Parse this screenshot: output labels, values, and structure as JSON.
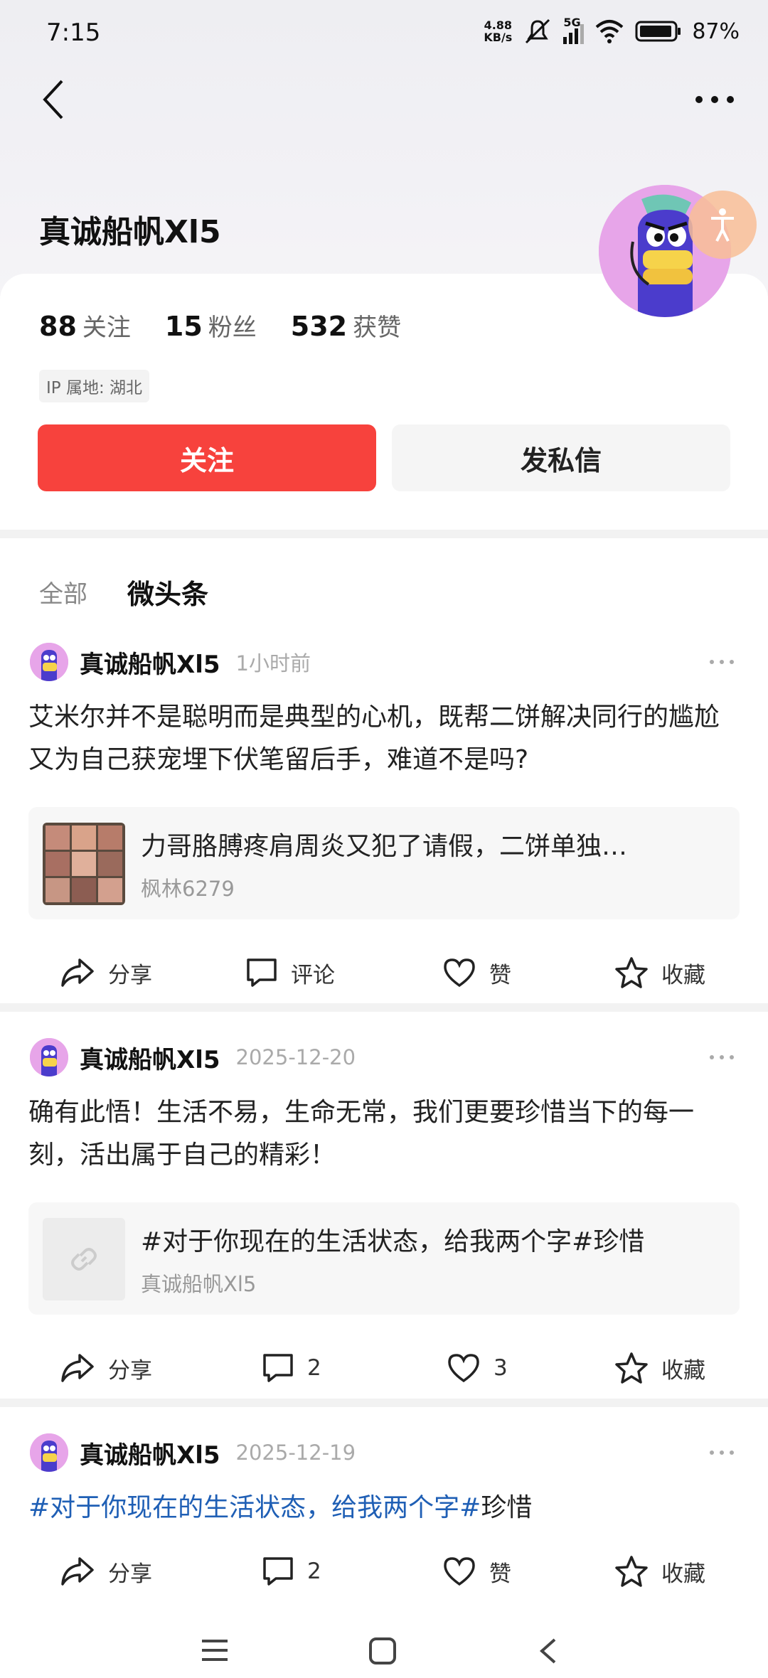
{
  "status": {
    "time": "7:15",
    "speed_value": "4.88",
    "speed_unit": "KB/s",
    "network": "5G",
    "battery": "87%"
  },
  "profile": {
    "name": "真诚船帆Xl5",
    "following_count": "88",
    "following_label": "关注",
    "fans_count": "15",
    "fans_label": "粉丝",
    "likes_count": "532",
    "likes_label": "获赞",
    "ip_location": "IP 属地: 湖北",
    "follow_btn": "关注",
    "message_btn": "发私信"
  },
  "tabs": [
    {
      "label": "全部"
    },
    {
      "label": "微头条"
    }
  ],
  "posts": [
    {
      "author": "真诚船帆Xl5",
      "time": "1小时前",
      "text": "艾米尔并不是聪明而是典型的心机，既帮二饼解决同行的尴尬又为自己获宠埋下伏笔留后手，难道不是吗?",
      "quote_title": "力哥胳膊疼肩周炎又犯了请假，二饼单独…",
      "quote_source": "枫林6279",
      "share": "分享",
      "comment": "评论",
      "like": "赞",
      "fav": "收藏"
    },
    {
      "author": "真诚船帆Xl5",
      "time": "2025-12-20",
      "text": "确有此悟！生活不易，生命无常，我们更要珍惜当下的每一刻，活出属于自己的精彩！",
      "quote_title": "#对于你现在的生活状态，给我两个字#珍惜",
      "quote_source": "真诚船帆Xl5",
      "share": "分享",
      "comment": "2",
      "like": "3",
      "fav": "收藏"
    },
    {
      "author": "真诚船帆Xl5",
      "time": "2025-12-19",
      "text_link": "#对于你现在的生活状态，给我两个字#",
      "text_plain": "珍惜",
      "share": "分享",
      "comment": "2",
      "like": "赞",
      "fav": "收藏"
    }
  ],
  "icons": {
    "back": "back-arrow-icon",
    "more": "more-dots-icon",
    "share": "share-icon",
    "comment": "comment-icon",
    "like": "heart-icon",
    "fav": "star-icon",
    "link": "link-icon"
  },
  "colors": {
    "accent": "#f7423d",
    "link": "#1f5fb5",
    "muted": "#999999"
  }
}
